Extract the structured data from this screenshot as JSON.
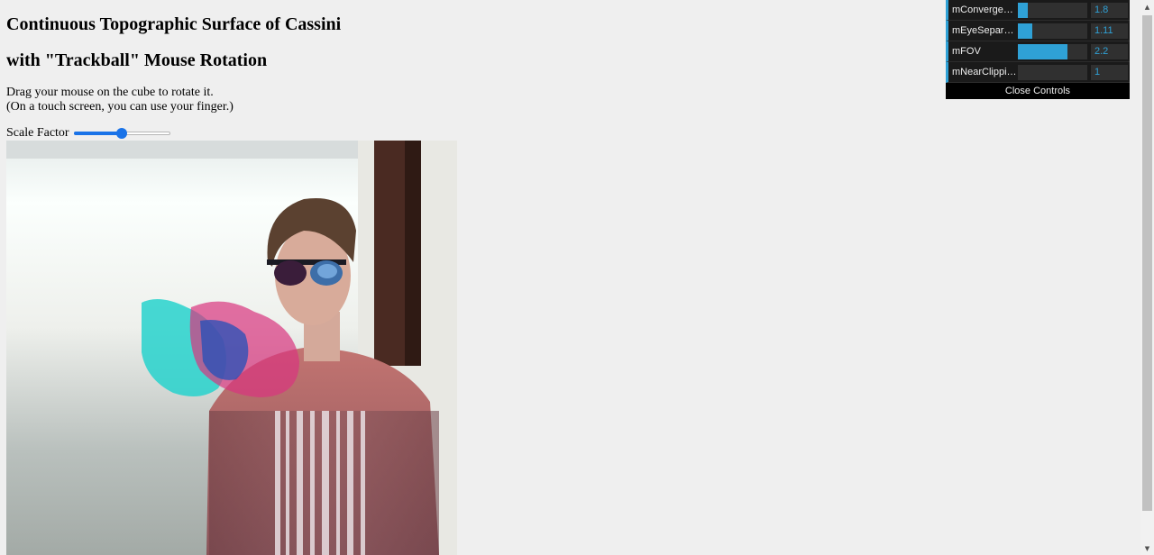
{
  "page": {
    "title_line1": "Continuous Topographic Surface of Cassini",
    "title_line2": "with \"Trackball\" Mouse Rotation",
    "instruction_line1": "Drag your mouse on the cube to rotate it.",
    "instruction_line2": "(On a touch screen, you can use your finger.)",
    "scale_label": "Scale Factor",
    "scale_value_fraction": 0.5
  },
  "gui": {
    "controls": [
      {
        "label": "mConvergence",
        "value": "1.8",
        "fill_fraction": 0.14
      },
      {
        "label": "mEyeSeparation",
        "value": "1.11",
        "fill_fraction": 0.21
      },
      {
        "label": "mFOV",
        "value": "2.2",
        "fill_fraction": 0.71
      },
      {
        "label": "mNearClippingD...",
        "value": "1",
        "fill_fraction": 0.0
      }
    ],
    "close_label": "Close Controls",
    "accent_color": "#2fa1d6"
  },
  "scrollbar": {
    "up_icon": "triangle-up",
    "down_icon": "triangle-down"
  }
}
